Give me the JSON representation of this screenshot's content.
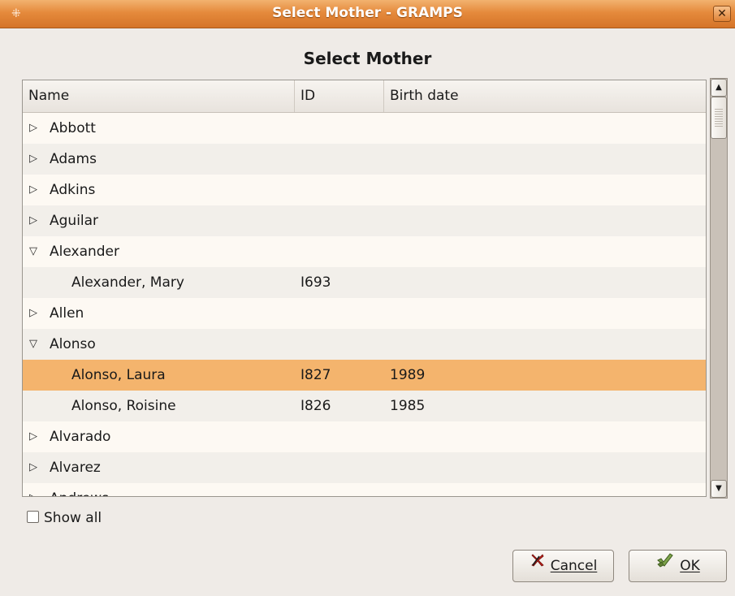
{
  "window": {
    "title": "Select Mother - GRAMPS"
  },
  "dialog": {
    "heading": "Select Mother"
  },
  "table": {
    "columns": [
      "Name",
      "ID",
      "Birth date"
    ],
    "rows": [
      {
        "name": "Abbott",
        "id": "",
        "birth": "",
        "kind": "group",
        "expanded": false
      },
      {
        "name": "Adams",
        "id": "",
        "birth": "",
        "kind": "group",
        "expanded": false
      },
      {
        "name": "Adkins",
        "id": "",
        "birth": "",
        "kind": "group",
        "expanded": false
      },
      {
        "name": "Aguilar",
        "id": "",
        "birth": "",
        "kind": "group",
        "expanded": false
      },
      {
        "name": "Alexander",
        "id": "",
        "birth": "",
        "kind": "group",
        "expanded": true
      },
      {
        "name": "Alexander, Mary",
        "id": "I693",
        "birth": "",
        "kind": "person"
      },
      {
        "name": "Allen",
        "id": "",
        "birth": "",
        "kind": "group",
        "expanded": false
      },
      {
        "name": "Alonso",
        "id": "",
        "birth": "",
        "kind": "group",
        "expanded": true
      },
      {
        "name": "Alonso, Laura",
        "id": "I827",
        "birth": "1989",
        "kind": "person",
        "selected": true
      },
      {
        "name": "Alonso, Roisine",
        "id": "I826",
        "birth": "1985",
        "kind": "person"
      },
      {
        "name": "Alvarado",
        "id": "",
        "birth": "",
        "kind": "group",
        "expanded": false
      },
      {
        "name": "Alvarez",
        "id": "",
        "birth": "",
        "kind": "group",
        "expanded": false
      },
      {
        "name": "Andrews",
        "id": "",
        "birth": "",
        "kind": "group",
        "expanded": false
      }
    ]
  },
  "options": {
    "show_all_label": "Show all",
    "show_all_checked": false
  },
  "buttons": {
    "cancel_label": "Cancel",
    "ok_label": "OK"
  },
  "colors": {
    "titlebar_accent": "#e58a3c",
    "selected_row": "#f4b46d"
  }
}
